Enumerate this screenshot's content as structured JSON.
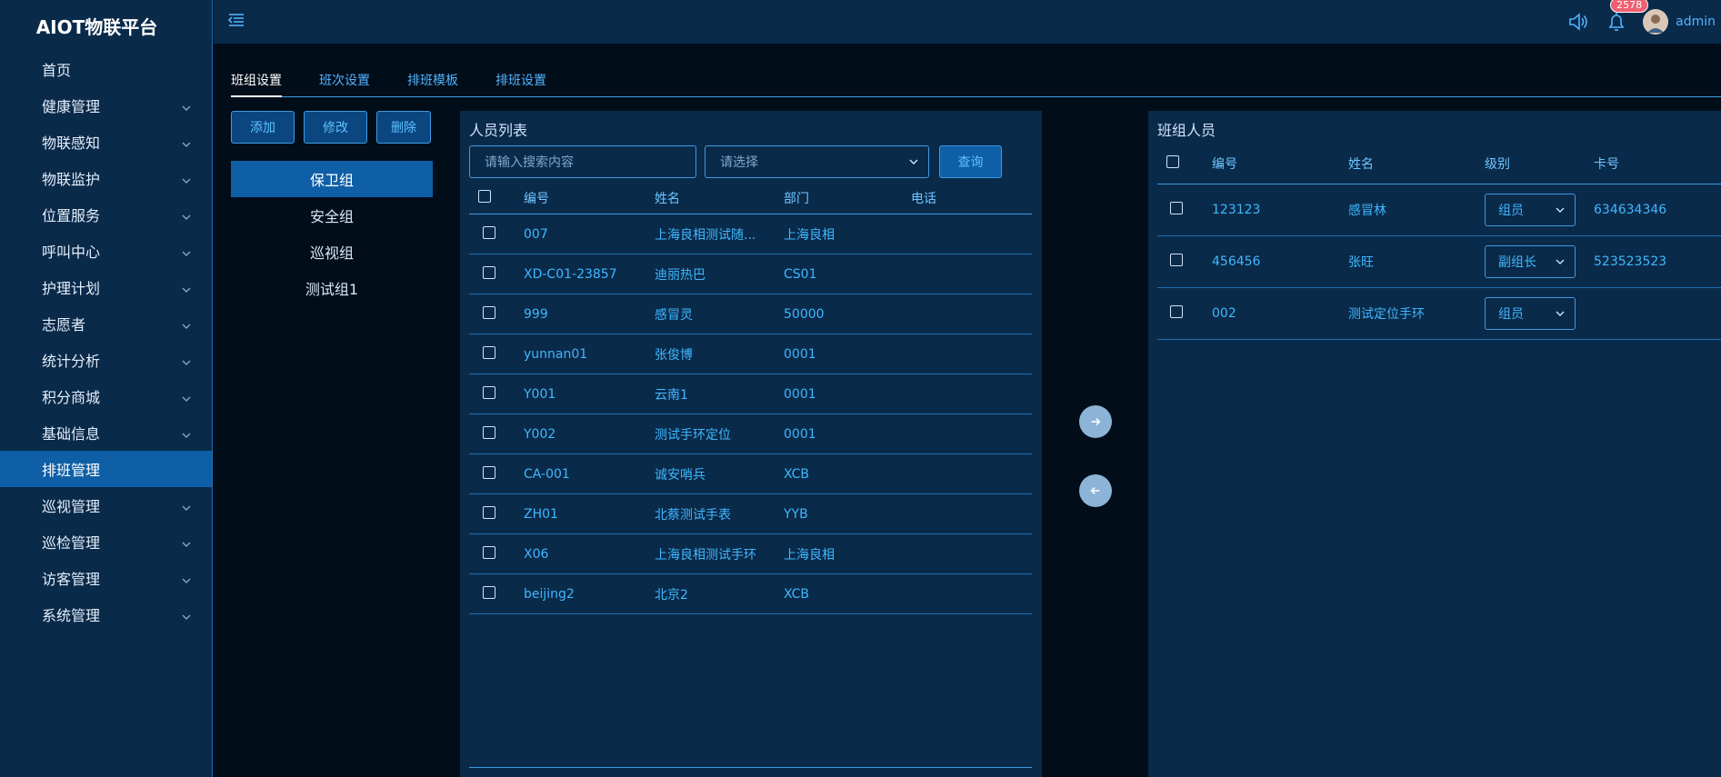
{
  "app": {
    "title": "AIOT物联平台"
  },
  "sidebar": {
    "items": [
      {
        "label": "首页",
        "has_children": false,
        "active": false
      },
      {
        "label": "健康管理",
        "has_children": true,
        "active": false
      },
      {
        "label": "物联感知",
        "has_children": true,
        "active": false
      },
      {
        "label": "物联监护",
        "has_children": true,
        "active": false
      },
      {
        "label": "位置服务",
        "has_children": true,
        "active": false
      },
      {
        "label": "呼叫中心",
        "has_children": true,
        "active": false
      },
      {
        "label": "护理计划",
        "has_children": true,
        "active": false
      },
      {
        "label": "志愿者",
        "has_children": true,
        "active": false
      },
      {
        "label": "统计分析",
        "has_children": true,
        "active": false
      },
      {
        "label": "积分商城",
        "has_children": true,
        "active": false
      },
      {
        "label": "基础信息",
        "has_children": true,
        "active": false
      },
      {
        "label": "排班管理",
        "has_children": false,
        "active": true
      },
      {
        "label": "巡视管理",
        "has_children": true,
        "active": false
      },
      {
        "label": "巡检管理",
        "has_children": true,
        "active": false
      },
      {
        "label": "访客管理",
        "has_children": true,
        "active": false
      },
      {
        "label": "系统管理",
        "has_children": true,
        "active": false
      }
    ]
  },
  "header": {
    "notification_count": "2578",
    "username": "admin"
  },
  "tabs": [
    {
      "label": "班组设置",
      "active": true
    },
    {
      "label": "班次设置",
      "active": false
    },
    {
      "label": "排班模板",
      "active": false
    },
    {
      "label": "排班设置",
      "active": false
    }
  ],
  "group_panel": {
    "add_label": "添加",
    "edit_label": "修改",
    "delete_label": "删除",
    "groups": [
      {
        "name": "保卫组",
        "active": true
      },
      {
        "name": "安全组",
        "active": false
      },
      {
        "name": "巡视组",
        "active": false
      },
      {
        "name": "测试组1",
        "active": false
      }
    ]
  },
  "personnel": {
    "title": "人员列表",
    "search_placeholder": "请输入搜索内容",
    "select_placeholder": "请选择",
    "query_label": "查询",
    "columns": [
      "编号",
      "姓名",
      "部门",
      "电话"
    ],
    "rows": [
      {
        "id": "007",
        "name": "上海良相测试随...",
        "dept": "上海良相",
        "phone": ""
      },
      {
        "id": "XD-C01-23857",
        "name": "迪丽热巴",
        "dept": "CS01",
        "phone": ""
      },
      {
        "id": "999",
        "name": "感冒灵",
        "dept": "50000",
        "phone": ""
      },
      {
        "id": "yunnan01",
        "name": "张俊博",
        "dept": "0001",
        "phone": ""
      },
      {
        "id": "Y001",
        "name": "云南1",
        "dept": "0001",
        "phone": ""
      },
      {
        "id": "Y002",
        "name": "测试手环定位",
        "dept": "0001",
        "phone": ""
      },
      {
        "id": "CA-001",
        "name": "诚安哨兵",
        "dept": "XCB",
        "phone": ""
      },
      {
        "id": "ZH01",
        "name": "北蔡测试手表",
        "dept": "YYB",
        "phone": ""
      },
      {
        "id": "X06",
        "name": "上海良相测试手环",
        "dept": "上海良相",
        "phone": ""
      },
      {
        "id": "beijing2",
        "name": "北京2",
        "dept": "XCB",
        "phone": ""
      }
    ]
  },
  "members": {
    "title": "班组人员",
    "columns": [
      "编号",
      "姓名",
      "级别",
      "卡号"
    ],
    "rows": [
      {
        "id": "123123",
        "name": "感冒林",
        "level": "组员",
        "card": "634634346"
      },
      {
        "id": "456456",
        "name": "张旺",
        "level": "副组长",
        "card": "523523523"
      },
      {
        "id": "002",
        "name": "测试定位手环",
        "level": "组员",
        "card": ""
      }
    ]
  }
}
